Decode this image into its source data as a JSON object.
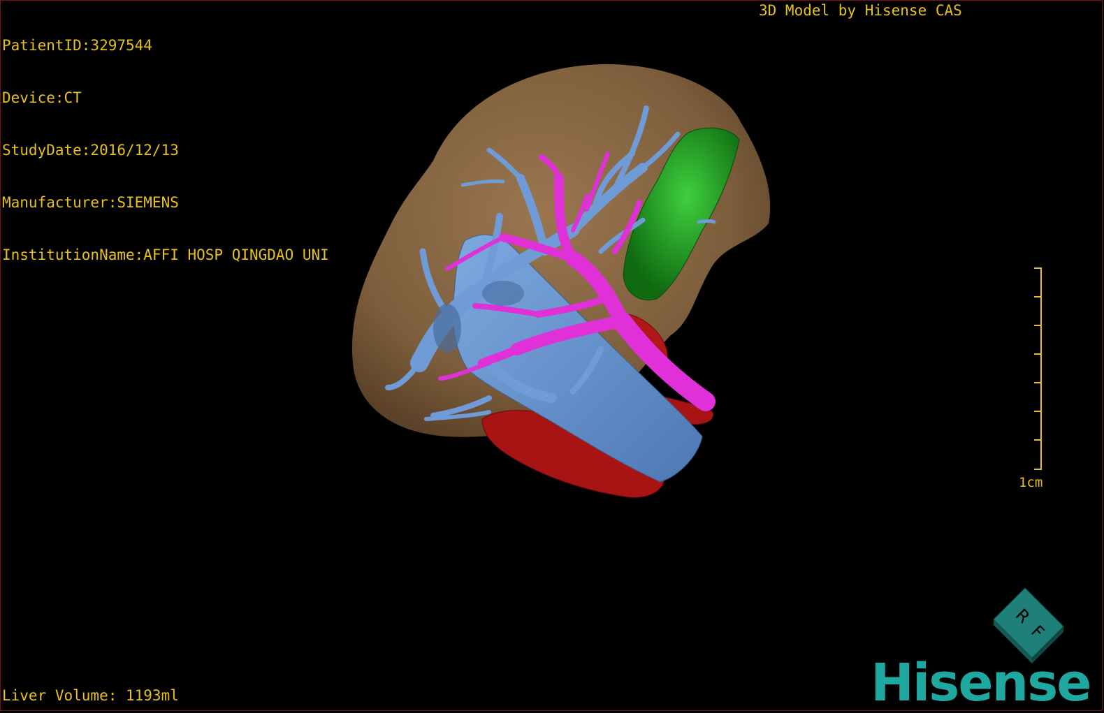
{
  "header": {
    "patient_id": "PatientID:3297544",
    "device": "Device:CT",
    "study_date": "StudyDate:2016/12/13",
    "manufacturer": "Manufacturer:SIEMENS",
    "institution": "InstitutionName:AFFI HOSP QINGDAO UNI",
    "model_by": "3D Model by Hisense CAS"
  },
  "footer": {
    "liver_volume": "Liver Volume: 1193ml"
  },
  "scale_bar": {
    "label": "1cm"
  },
  "orientation_cube": {
    "face_right": "R",
    "face_front": "F"
  },
  "branding": {
    "logo_text": "Hisense",
    "logo_color": "#1fa8a0"
  },
  "model_colors": {
    "liver": "#8b6a45",
    "portal_vein": "#e030d8",
    "hepatic_vein": "#6f9bd6",
    "artery": "#b01818",
    "gallbladder": "#1f8f1f"
  }
}
